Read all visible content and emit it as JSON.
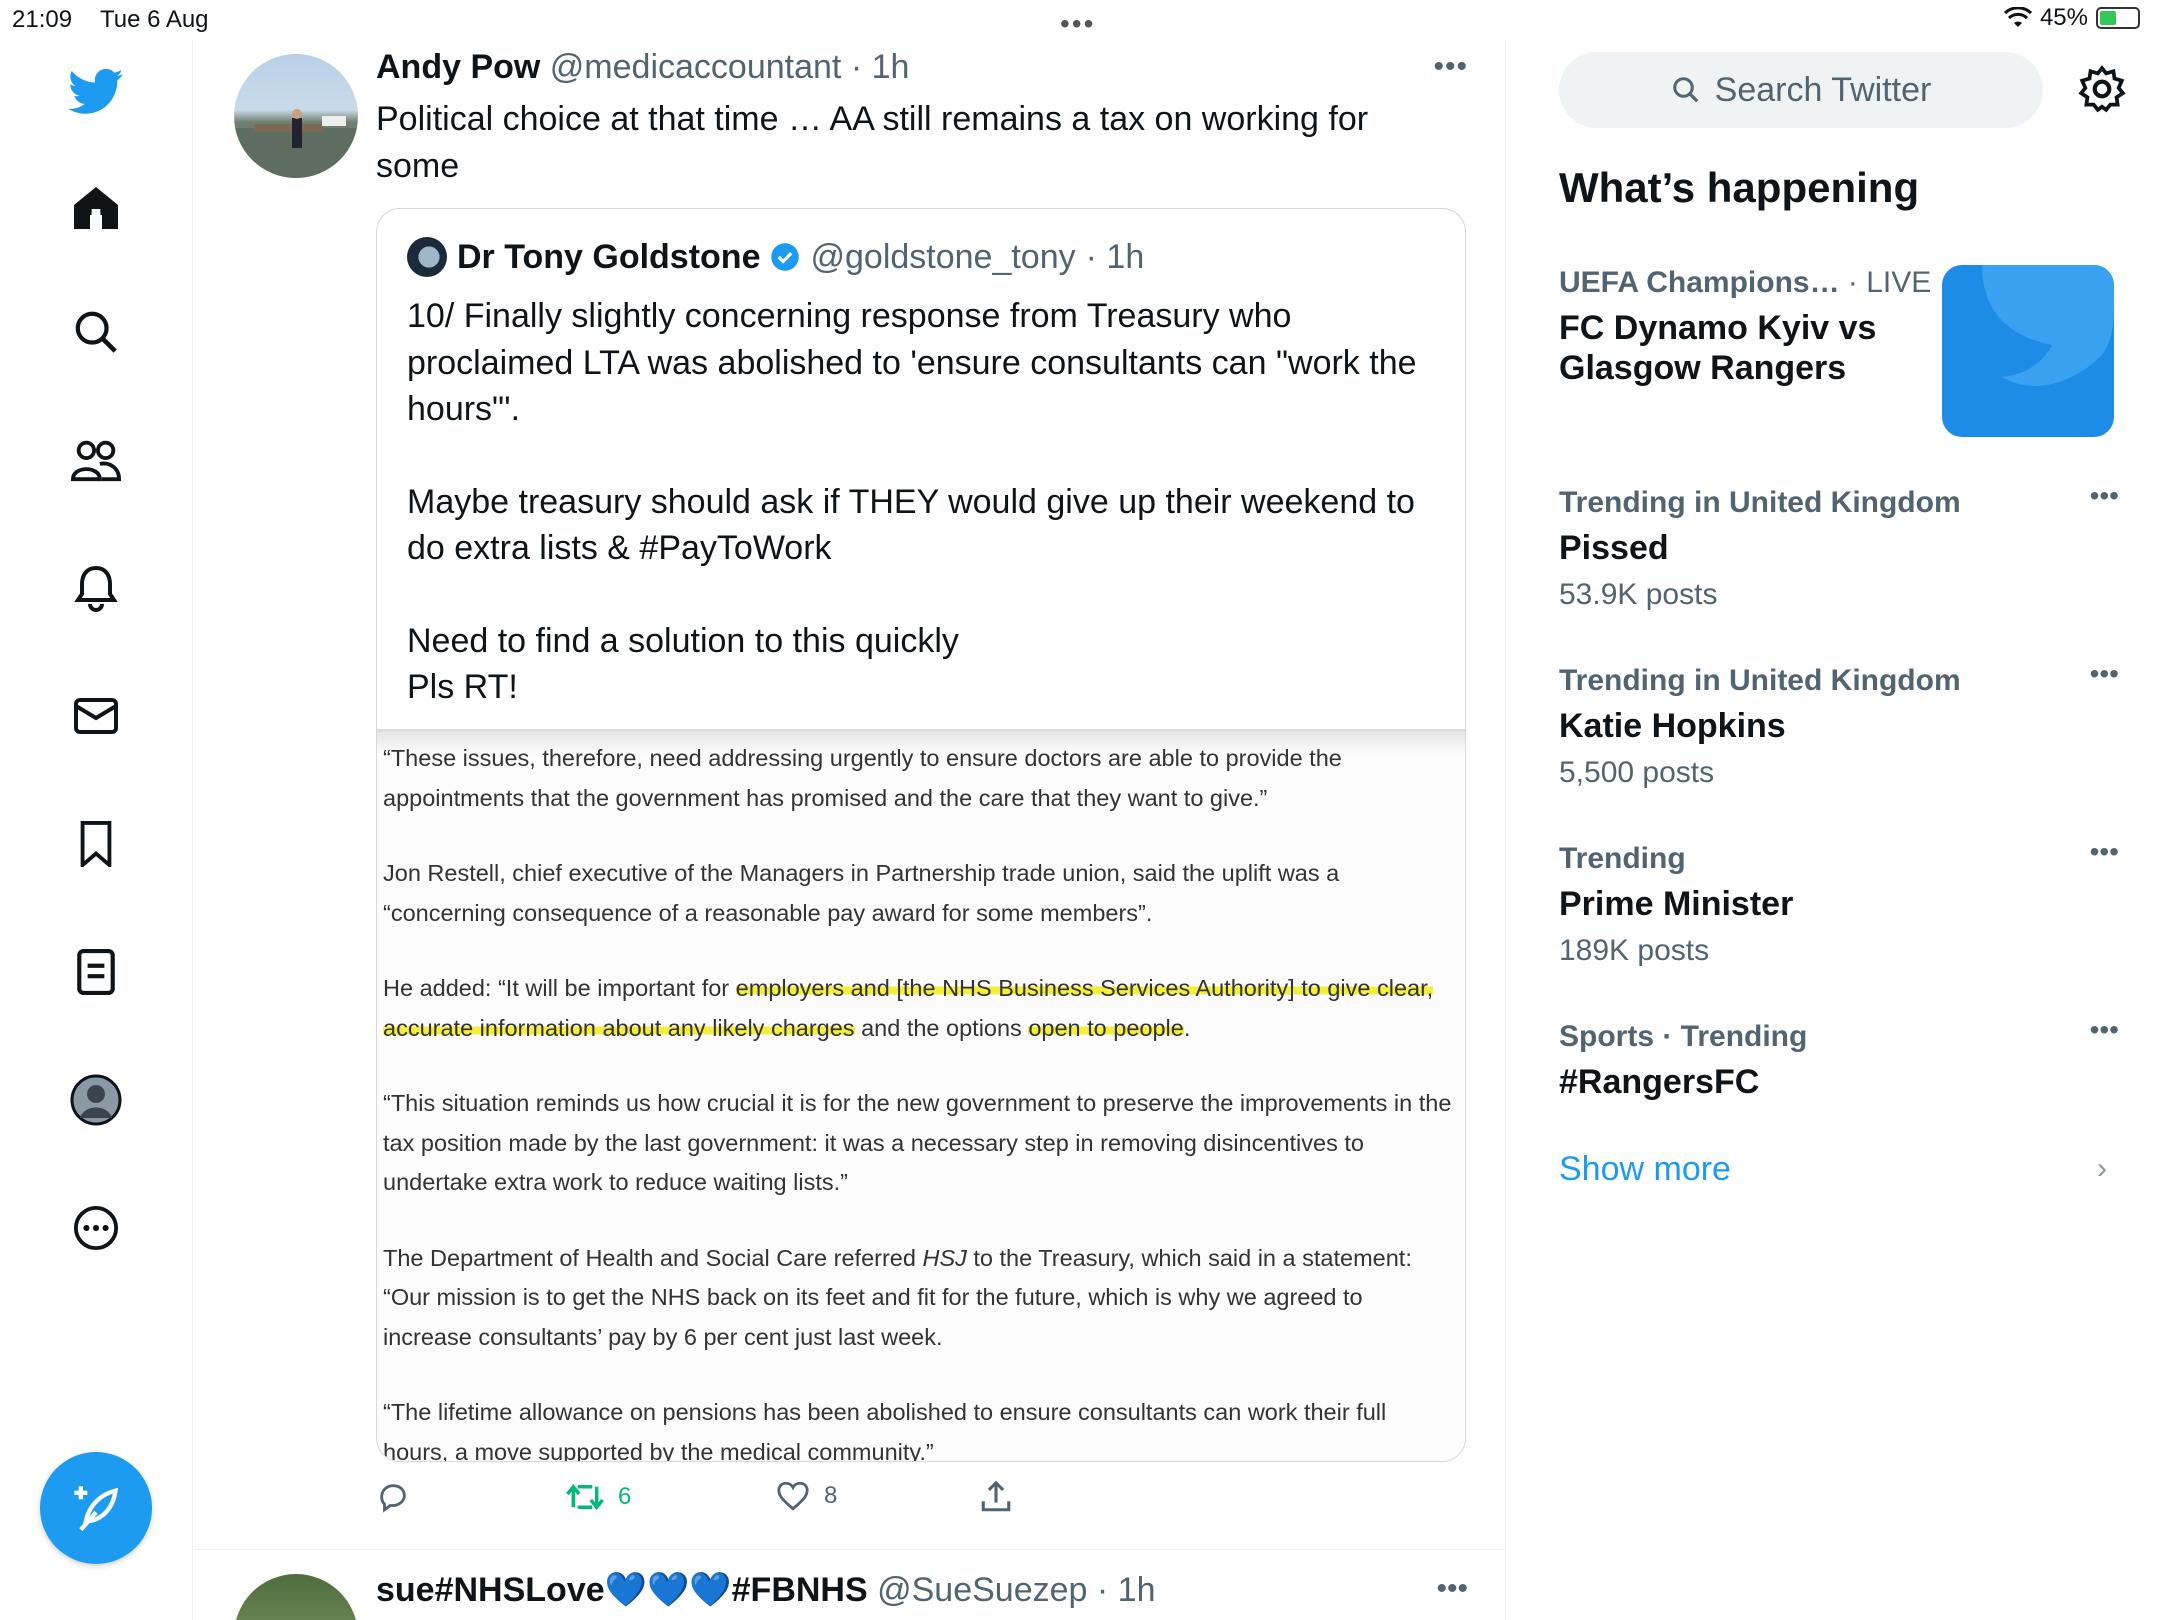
{
  "status": {
    "time": "21:09",
    "date": "Tue 6 Aug",
    "battery": "45%",
    "battery_level": 0.45
  },
  "nav": {
    "items": [
      "home",
      "explore",
      "communities",
      "notifications",
      "messages",
      "bookmarks",
      "lists",
      "profile",
      "more"
    ]
  },
  "tweet": {
    "name": "Andy Pow",
    "handle": "@medicaccountant",
    "time": "· 1h",
    "text": "Political choice at that time … AA still remains a tax on working for some",
    "quote": {
      "name": "Dr Tony Goldstone",
      "handle": "@goldstone_tony",
      "time": "· 1h",
      "para1": "10/ Finally slightly concerning response from Treasury who proclaimed LTA was abolished to 'ensure consultants can \"work the hours\"'.",
      "para2": "Maybe treasury should ask if THEY would give up their weekend to do extra lists & #PayToWork",
      "para3_line1": "Need to find a solution to this quickly",
      "para3_line2": "Pls RT!",
      "image": {
        "p1": "“These issues, therefore, need addressing urgently to ensure doctors are able to provide the appointments that the government has promised and the care that they want to give.”",
        "p2": "Jon Restell, chief executive of the Managers in Partnership trade union, said the uplift was a “concerning consequence of a reasonable pay award for some members”.",
        "p3_pre": "He added: “It will be important for ",
        "p3_hl1": "employers and [the NHS Business Services Authority] to give clear, accurate information about any likely charges",
        "p3_mid": " and the options ",
        "p3_hl2": "open to people",
        "p3_post": ".",
        "p4": "“This situation reminds us how crucial it is for the new government to preserve the improvements in the tax position made by the last government: it was a necessary step in removing disincentives to undertake extra work to reduce waiting lists.”",
        "p5_pre": "The Department of Health and Social Care referred ",
        "p5_em": "HSJ",
        "p5_post": " to the Treasury, which said in a statement: “Our mission is to get the NHS back on its feet and fit for the future, which is why we agreed to increase consultants’ pay by 6 per cent just last week.",
        "p6": "“The lifetime allowance on pensions has been abolished to ensure consultants can work their full hours, a move supported by the medical community.”"
      }
    },
    "retweets": "6",
    "likes": "8"
  },
  "tweet2": {
    "name": "sue#NHSLove💙💙💙#FBNHS",
    "handle": "@SueSuezep",
    "time": "· 1h"
  },
  "sidebar": {
    "search_placeholder": "Search Twitter",
    "title": "What’s happening",
    "trends": [
      {
        "meta": "UEFA Champions…",
        "live": " · LIVE",
        "name": "FC Dynamo Kyiv vs Glasgow Rangers"
      },
      {
        "meta": "Trending in United Kingdom",
        "name": "Pissed",
        "posts": "53.9K posts"
      },
      {
        "meta": "Trending in United Kingdom",
        "name": "Katie Hopkins",
        "posts": "5,500 posts"
      },
      {
        "meta": "Trending",
        "name": "Prime Minister",
        "posts": "189K posts"
      },
      {
        "meta": "Sports · Trending",
        "name": "#RangersFC"
      }
    ],
    "show_more": "Show more"
  },
  "colors": {
    "brand": "#1d9bf0",
    "retweet": "#00ba7c",
    "highlight": "#f3ee3a"
  }
}
